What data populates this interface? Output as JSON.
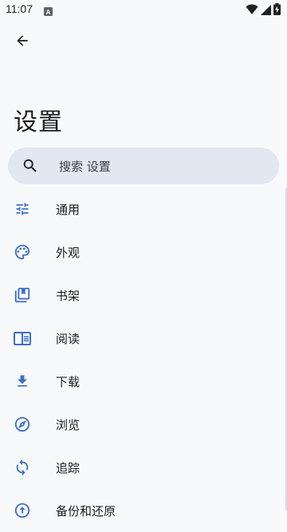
{
  "status_bar": {
    "time": "11:07",
    "notification_icon": "a-icon",
    "wifi_icon": "wifi-icon",
    "signal_icon": "signal-icon",
    "battery_icon": "battery-charging-icon"
  },
  "toolbar": {
    "back_icon": "arrow-back-icon"
  },
  "page": {
    "title": "设置"
  },
  "search": {
    "placeholder": "搜索 设置",
    "icon": "search-icon"
  },
  "colors": {
    "accent": "#3d6ec8",
    "background": "#f8f9fb",
    "search_bg": "#e2e8f1",
    "text": "#1b1c1f"
  },
  "menu": {
    "items": [
      {
        "label": "通用",
        "icon": "tune-icon"
      },
      {
        "label": "外观",
        "icon": "palette-icon"
      },
      {
        "label": "书架",
        "icon": "library-icon"
      },
      {
        "label": "阅读",
        "icon": "book-open-icon"
      },
      {
        "label": "下载",
        "icon": "download-icon"
      },
      {
        "label": "浏览",
        "icon": "compass-icon"
      },
      {
        "label": "追踪",
        "icon": "sync-icon"
      },
      {
        "label": "备份和还原",
        "icon": "backup-icon"
      }
    ]
  }
}
